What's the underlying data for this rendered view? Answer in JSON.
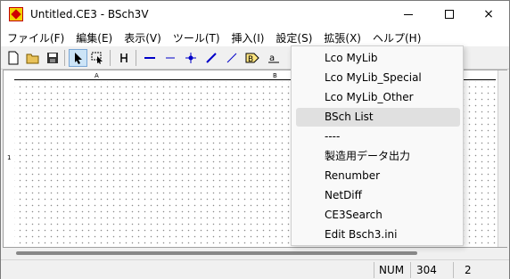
{
  "window": {
    "title": "Untitled.CE3 - BSch3V",
    "icon": "bsch-app-icon",
    "controls": {
      "minimize": "minimize-icon",
      "maximize": "maximize-icon",
      "close": "×"
    }
  },
  "menubar": {
    "items": [
      {
        "label": "ファイル(F)"
      },
      {
        "label": "編集(E)"
      },
      {
        "label": "表示(V)"
      },
      {
        "label": "ツール(T)"
      },
      {
        "label": "挿入(I)"
      },
      {
        "label": "設定(S)"
      },
      {
        "label": "拡張(X)"
      },
      {
        "label": "ヘルプ(H)"
      }
    ]
  },
  "toolbar": {
    "buttons": [
      "new-file-icon",
      "open-folder-icon",
      "save-icon",
      "select-arrow-icon",
      "drag-select-icon",
      "junction-tool-icon",
      "wire-icon",
      "bus-icon",
      "junction-dot-icon",
      "entry-line-icon",
      "entry-line-thin-icon",
      "tag-icon",
      "label-icon"
    ]
  },
  "canvas": {
    "ruler_top_labels": [
      "A",
      "B"
    ],
    "ruler_left_labels": [
      "1"
    ]
  },
  "dropdown": {
    "items": [
      {
        "label": "Lco MyLib"
      },
      {
        "label": "Lco MyLib_Special"
      },
      {
        "label": "Lco MyLib_Other"
      },
      {
        "label": "BSch List",
        "highlighted": true
      },
      {
        "label": "----"
      },
      {
        "label": "製造用データ出力"
      },
      {
        "label": "Renumber"
      },
      {
        "label": "NetDiff"
      },
      {
        "label": "CE3Search"
      },
      {
        "label": "Edit Bsch3.ini"
      }
    ]
  },
  "statusbar": {
    "num": "NUM",
    "x": "304",
    "y": "2"
  },
  "colors": {
    "accent": "#0000c8",
    "hover": "#e0e0e0",
    "toolbar_active": "#cce4f7"
  }
}
